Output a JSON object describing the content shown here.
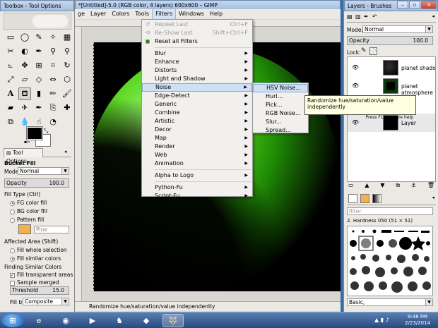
{
  "toolbox": {
    "title": "Toolbox - Tool Options",
    "dock_tab": "Tool Options",
    "tool_name": "Bucket Fill",
    "mode_label": "Mode",
    "mode_value": "Normal",
    "opacity_label": "Opacity",
    "opacity_value": "100.0",
    "fill_type_label": "Fill Type  (Ctrl)",
    "fill_types": [
      "FG color fill",
      "BG color fill",
      "Pattern fill"
    ],
    "pattern_name": "Pine",
    "affected_area_label": "Affected Area  (Shift)",
    "affected_areas": [
      "Fill whole selection",
      "Fill similar colors"
    ],
    "finding_label": "Finding Similar Colors",
    "fill_transparent": "Fill transparent areas",
    "sample_merged": "Sample merged",
    "threshold_label": "Threshold",
    "threshold_value": "15.0",
    "fill_by_label": "Fill by:",
    "fill_by_value": "Composite"
  },
  "image_window": {
    "title": "*[Untitled]-5.0 (RGB color, 4 layers) 600x600 – GIMP",
    "menus": [
      "ge",
      "Layer",
      "Colors",
      "Tools",
      "Filters",
      "Windows",
      "Help"
    ],
    "status_text": "Randomize hue/saturation/value independently"
  },
  "filters_menu": {
    "repeat_last": "Repeat Last",
    "repeat_last_key": "Ctrl+F",
    "reshow_last": "Re-Show Last",
    "reshow_last_key": "Shift+Ctrl+F",
    "reset_all": "Reset all Filters",
    "items": [
      "Blur",
      "Enhance",
      "Distorts",
      "Light and Shadow",
      "Noise",
      "Edge-Detect",
      "Generic",
      "Combine",
      "Artistic",
      "Decor",
      "Map",
      "Render",
      "Web",
      "Animation"
    ],
    "alpha_to_logo": "Alpha to Logo",
    "script_items": [
      "Python-Fu",
      "Script-Fu"
    ]
  },
  "noise_submenu": {
    "items": [
      "HSV Noise...",
      "Hurl...",
      "Pick...",
      "RGB Noise...",
      "Slur...",
      "Spread..."
    ]
  },
  "tooltip": {
    "text": "Randomize hue/saturation/value independently",
    "help": "Press F1 for more help"
  },
  "layers_panel": {
    "title": "Layers - Brushes",
    "mode_label": "Mode:",
    "mode_value": "Normal",
    "opacity_label": "Opacity",
    "opacity_value": "100.0",
    "lock_label": "Lock:",
    "layers": [
      "planet shadow",
      "planet atmosphere",
      "",
      "Layer"
    ],
    "brush_filter_placeholder": "filter",
    "brush_name": "2. Hardness 050 (51 × 51)",
    "brush_tag": "Basic,"
  },
  "taskbar": {
    "time": "9:48 PM",
    "date": "2/23/2014"
  }
}
